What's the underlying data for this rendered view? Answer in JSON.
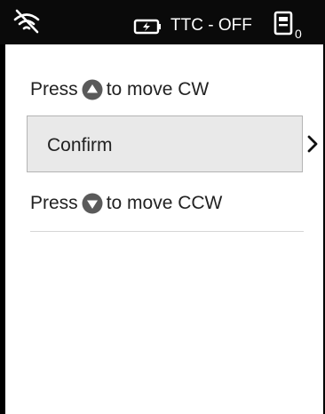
{
  "status_bar": {
    "wifi_icon": "wifi-off-icon",
    "battery_icon": "battery-charging-icon",
    "ttc_status": "TTC - OFF",
    "device_icon": "device-icon",
    "device_count": "0"
  },
  "content": {
    "cw_prefix": "Press",
    "cw_suffix": "to move CW",
    "cw_icon": "arrow-up-icon",
    "confirm_label": "Confirm",
    "confirm_chevron_icon": "chevron-right-icon",
    "ccw_prefix": "Press",
    "ccw_suffix": "to move CCW",
    "ccw_icon": "arrow-down-icon"
  },
  "colors": {
    "status_bar_bg": "#0a0a0a",
    "screen_bg": "#ffffff",
    "confirm_bg": "#e9e9e9",
    "arrow_button": "#5a5a5a"
  }
}
